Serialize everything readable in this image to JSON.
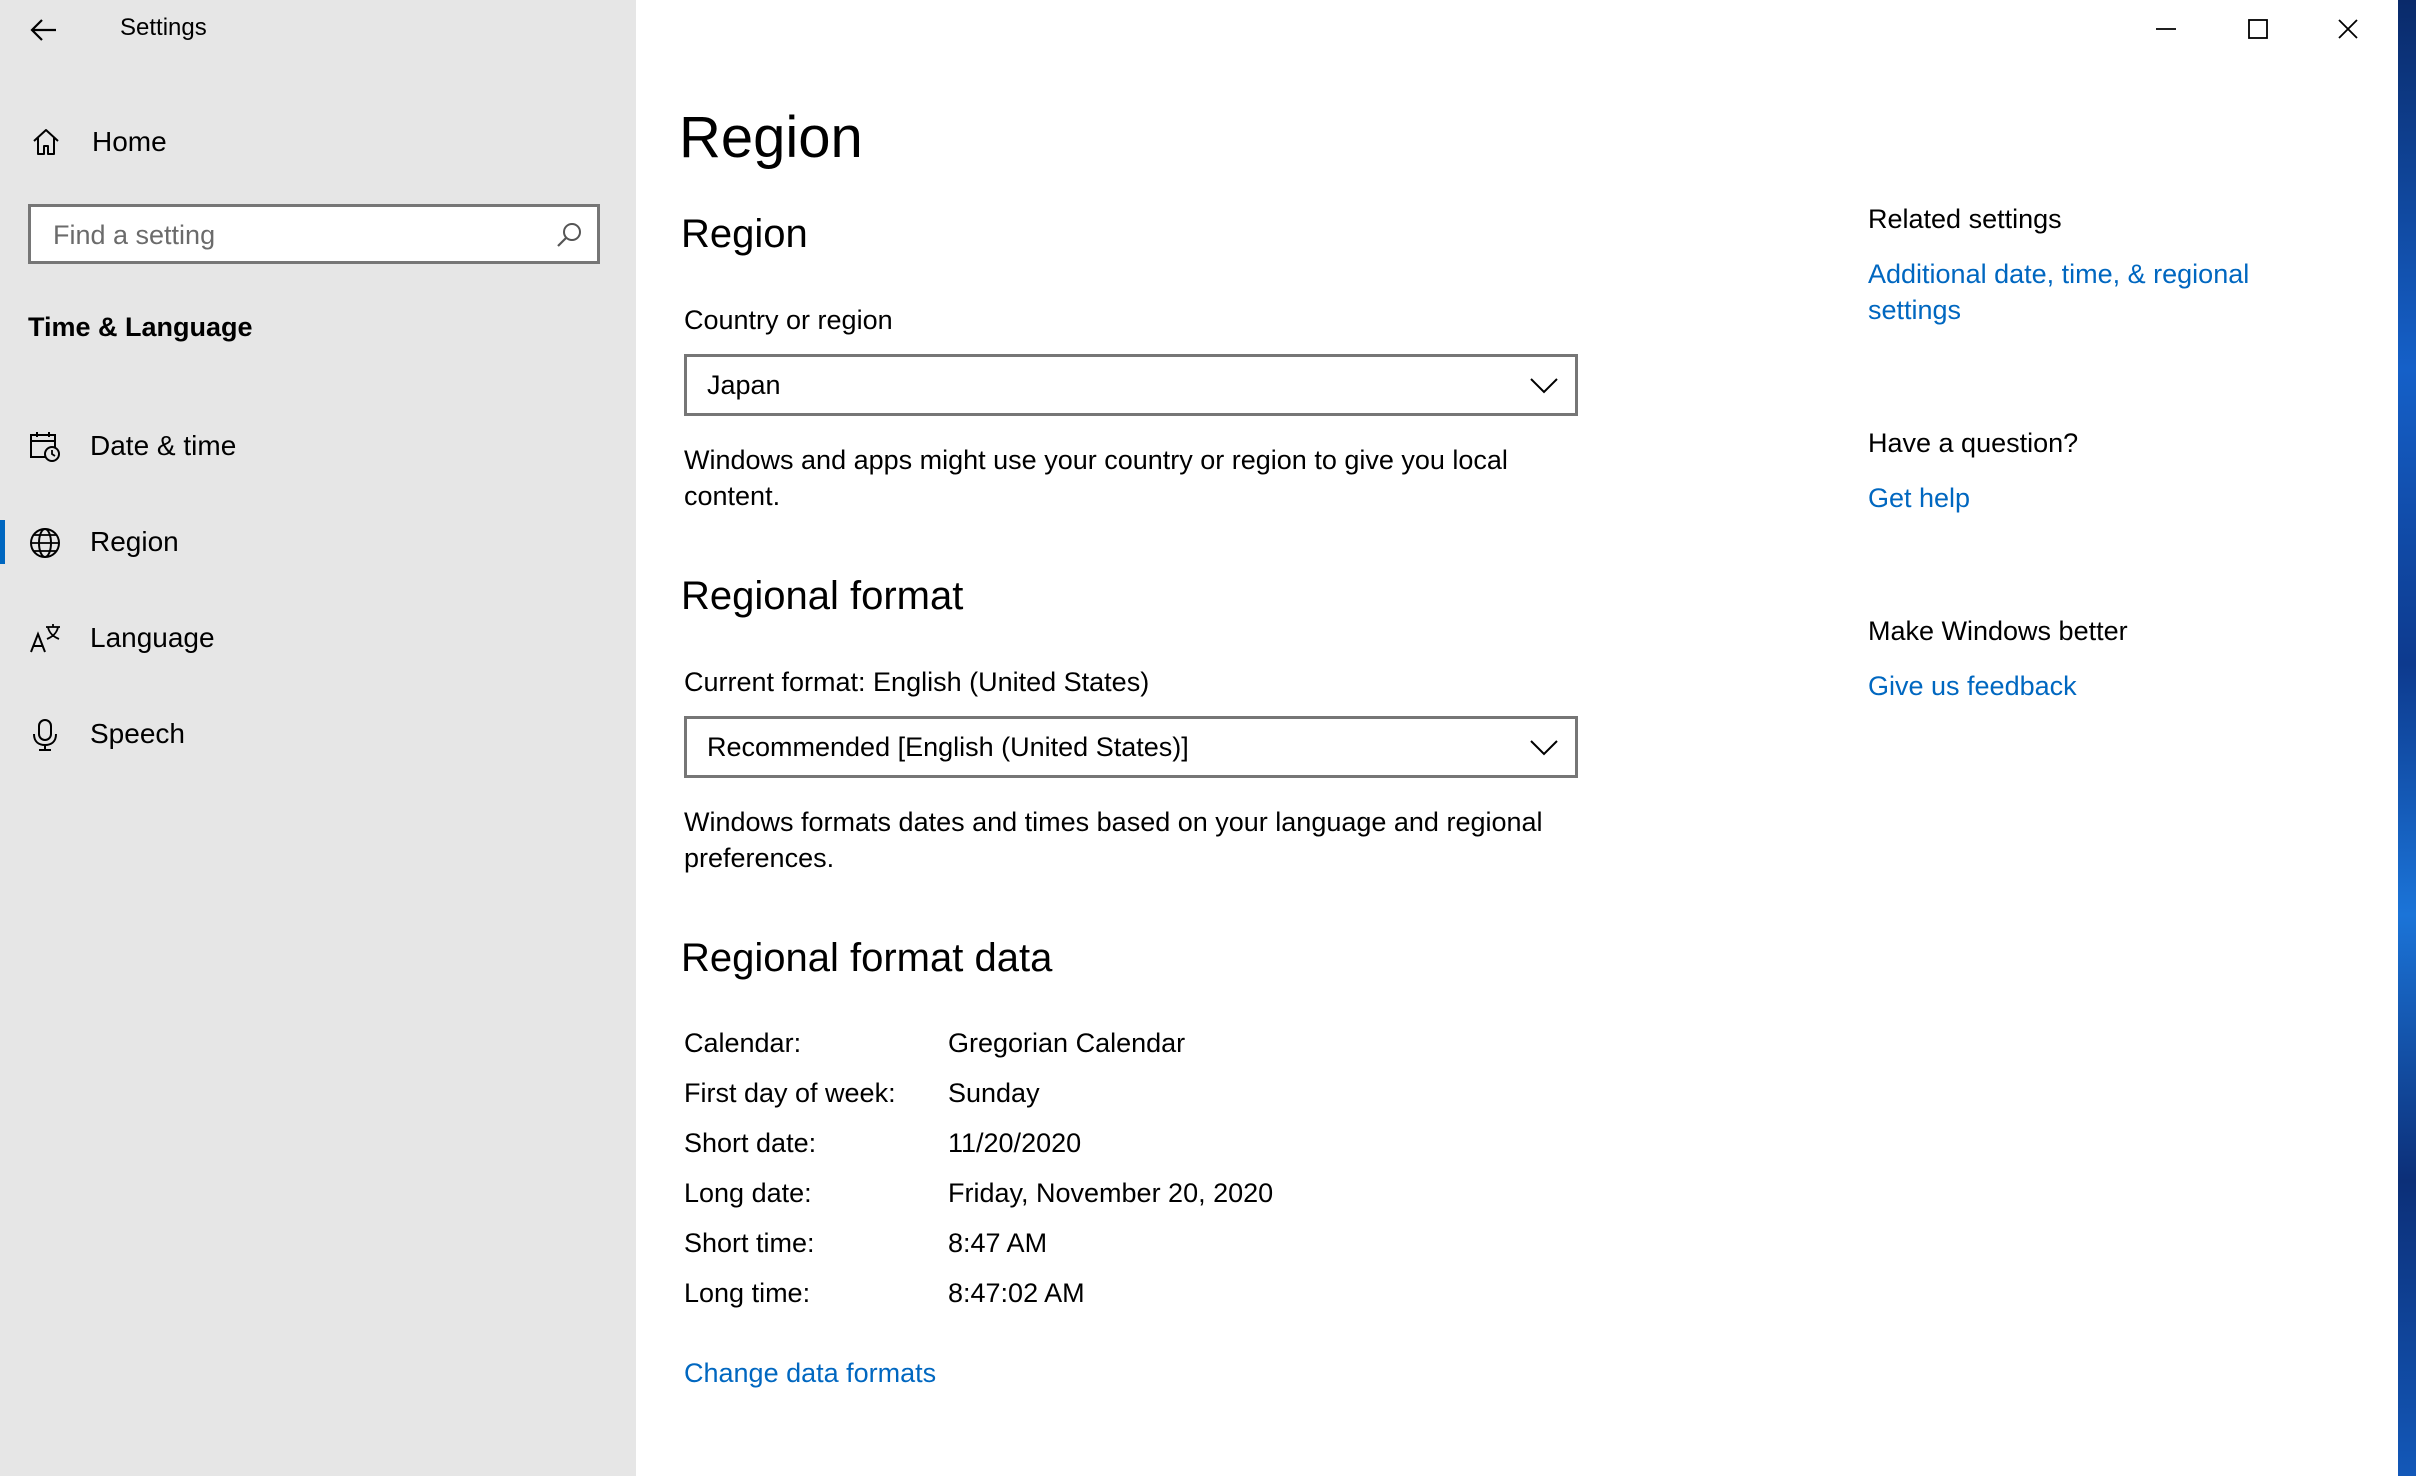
{
  "window": {
    "app_title": "Settings",
    "controls": {
      "minimize": "minimize-icon",
      "maximize": "maximize-icon",
      "close": "close-icon"
    }
  },
  "sidebar": {
    "home_label": "Home",
    "search_placeholder": "Find a setting",
    "section_title": "Time & Language",
    "items": [
      {
        "label": "Date & time",
        "icon": "calendar-clock-icon",
        "active": false
      },
      {
        "label": "Region",
        "icon": "globe-icon",
        "active": true
      },
      {
        "label": "Language",
        "icon": "language-icon",
        "active": false
      },
      {
        "label": "Speech",
        "icon": "microphone-icon",
        "active": false
      }
    ],
    "accent_color": "#0067c0"
  },
  "main": {
    "page_title": "Region",
    "region_heading": "Region",
    "country_label": "Country or region",
    "country_value": "Japan",
    "country_desc": "Windows and apps might use your country or region to give you local content.",
    "format_heading": "Regional format",
    "current_format_label": "Current format: English (United States)",
    "format_value": "Recommended [English (United States)]",
    "format_desc": "Windows formats dates and times based on your language and regional preferences.",
    "data_heading": "Regional format data",
    "format_data": [
      {
        "key": "Calendar:",
        "value": "Gregorian Calendar"
      },
      {
        "key": "First day of week:",
        "value": "Sunday"
      },
      {
        "key": "Short date:",
        "value": "11/20/2020"
      },
      {
        "key": "Long date:",
        "value": "Friday, November 20, 2020"
      },
      {
        "key": "Short time:",
        "value": "8:47 AM"
      },
      {
        "key": "Long time:",
        "value": "8:47:02 AM"
      }
    ],
    "change_link": "Change data formats"
  },
  "related": {
    "related_heading": "Related settings",
    "related_link": "Additional date, time, & regional settings",
    "question_heading": "Have a question?",
    "help_link": "Get help",
    "better_heading": "Make Windows better",
    "feedback_link": "Give us feedback"
  }
}
